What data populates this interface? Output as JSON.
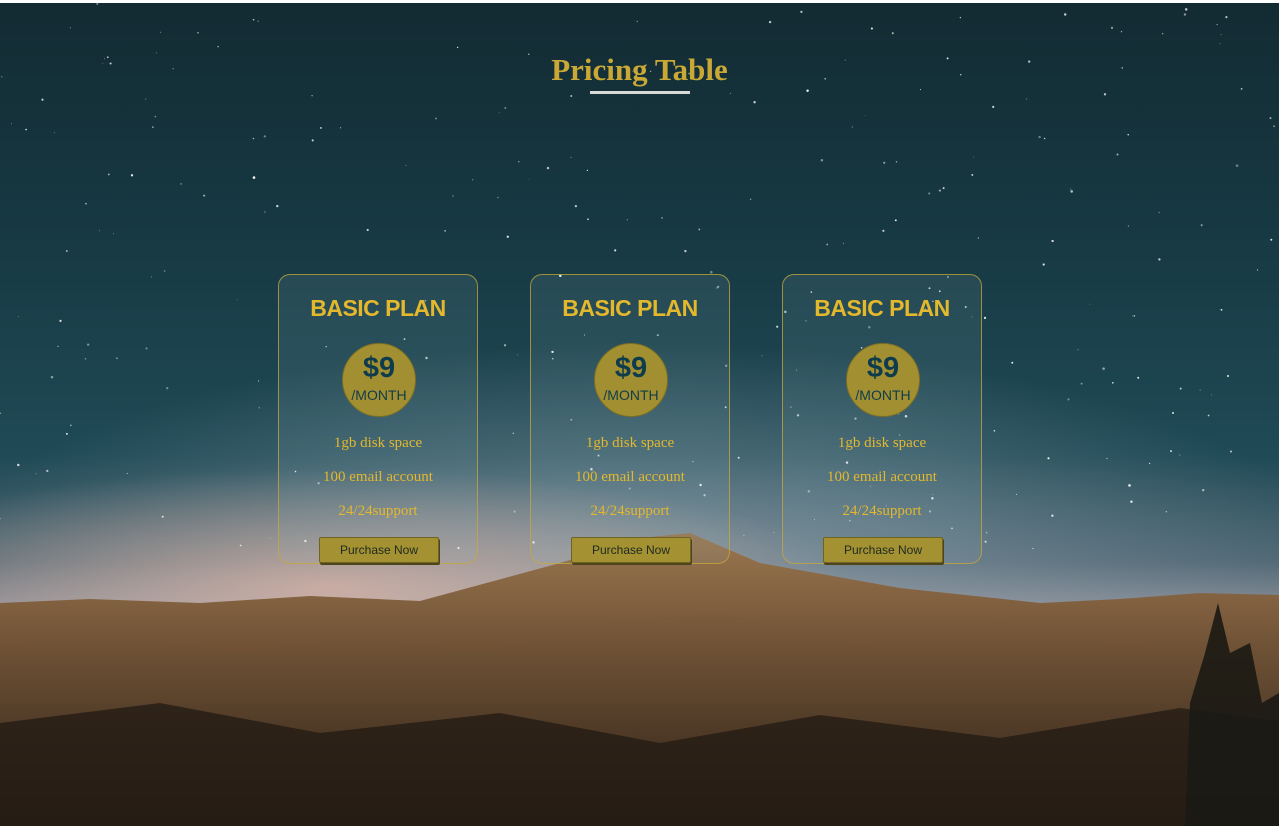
{
  "page": {
    "title": "Pricing Table"
  },
  "colors": {
    "accent": "#c9a836",
    "plan_text": "#e3b82d",
    "price_circle": "#a28f31",
    "price_text": "#0f3c4c",
    "button": "#a49131"
  },
  "plans": [
    {
      "name": "BASIC PLAN",
      "price": "$9",
      "period": "/MONTH",
      "features": [
        "1gb disk space",
        "100 email account",
        "24/24support"
      ],
      "button_label": "Purchase Now"
    },
    {
      "name": "BASIC PLAN",
      "price": "$9",
      "period": "/MONTH",
      "features": [
        "1gb disk space",
        "100 email account",
        "24/24support"
      ],
      "button_label": "Purchase Now"
    },
    {
      "name": "BASIC PLAN",
      "price": "$9",
      "period": "/MONTH",
      "features": [
        "1gb disk space",
        "100 email account",
        "24/24support"
      ],
      "button_label": "Purchase Now"
    }
  ]
}
